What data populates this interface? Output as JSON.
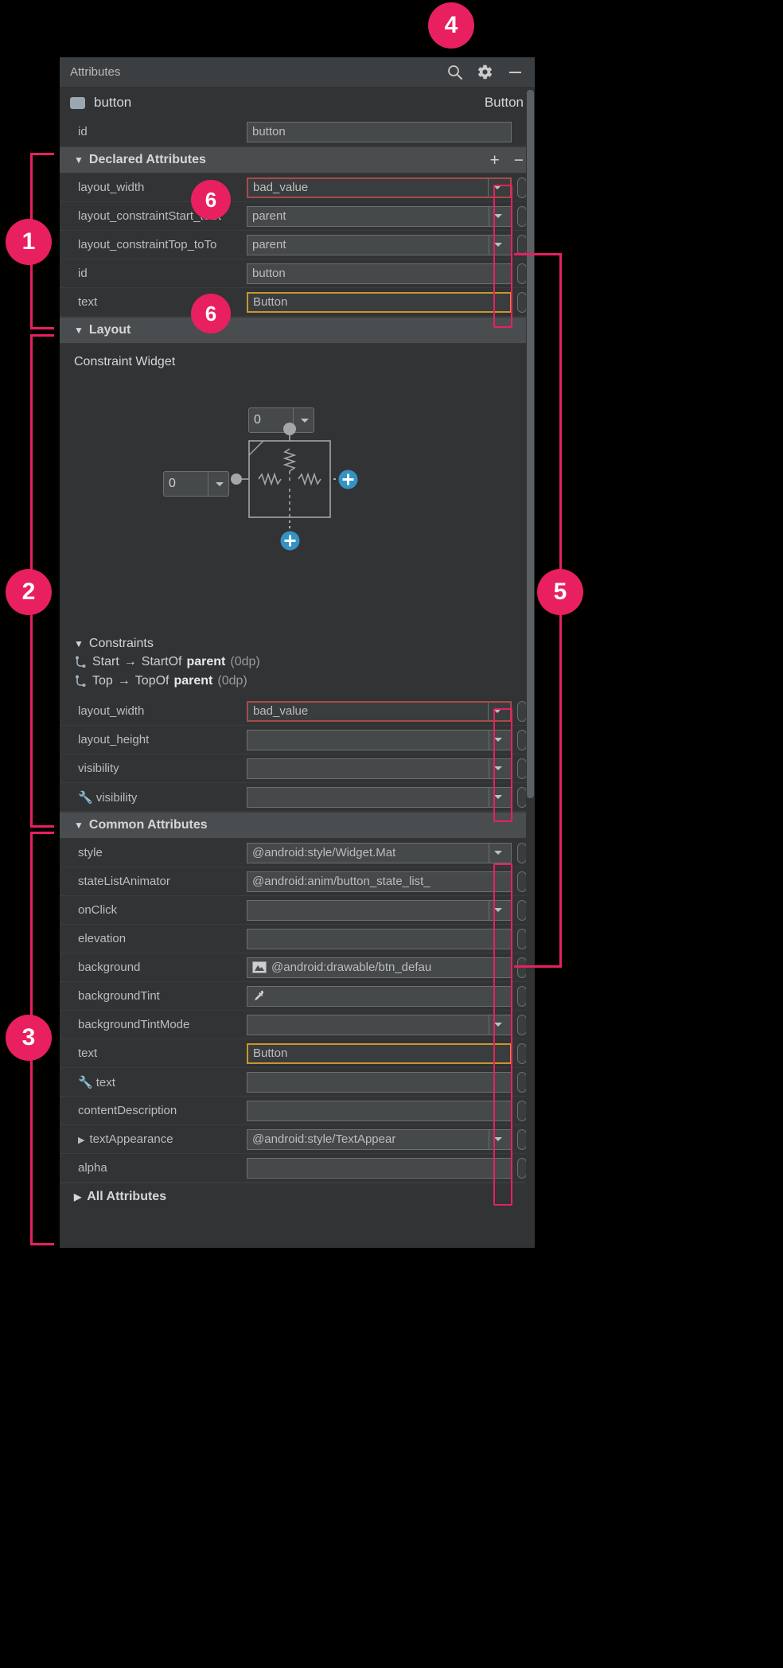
{
  "panel": {
    "title": "Attributes",
    "header_icons": [
      {
        "name": "search-icon",
        "label": "Search"
      },
      {
        "name": "gear-icon",
        "label": "Settings"
      },
      {
        "name": "minimize-icon",
        "label": "Minimize"
      }
    ],
    "component": {
      "name": "button",
      "type": "Button"
    },
    "id_row": {
      "label": "id",
      "value": "button"
    }
  },
  "declared": {
    "section_label": "Declared Attributes",
    "add_label": "+",
    "remove_label": "−",
    "rows": [
      {
        "label": "layout_width",
        "value": "bad_value",
        "state": "err",
        "dropdown": true
      },
      {
        "label": "layout_constraintStart_toSt",
        "value": "parent",
        "state": "none",
        "dropdown": true
      },
      {
        "label": "layout_constraintTop_toTo",
        "value": "parent",
        "state": "none",
        "dropdown": true
      },
      {
        "label": "id",
        "value": "button",
        "state": "none",
        "dropdown": false
      },
      {
        "label": "text",
        "value": "Button",
        "state": "warn",
        "dropdown": false
      }
    ]
  },
  "layout": {
    "section_label": "Layout",
    "widget_title": "Constraint Widget",
    "top_margin_value": "0",
    "left_margin_value": "0",
    "constraints_label": "Constraints",
    "constraint_lines": [
      {
        "from": "Start",
        "arrow": "→",
        "to": "StartOf",
        "target": "parent",
        "dp": "(0dp)"
      },
      {
        "from": "Top",
        "arrow": "→",
        "to": "TopOf",
        "target": "parent",
        "dp": "(0dp)"
      }
    ],
    "rows": [
      {
        "label": "layout_width",
        "value": "bad_value",
        "state": "err",
        "dropdown": true,
        "wrench": false
      },
      {
        "label": "layout_height",
        "value": "",
        "state": "none",
        "dropdown": true,
        "wrench": false
      },
      {
        "label": "visibility",
        "value": "",
        "state": "none",
        "dropdown": true,
        "wrench": false
      },
      {
        "label": "visibility",
        "value": "",
        "state": "none",
        "dropdown": true,
        "wrench": true
      }
    ]
  },
  "common": {
    "section_label": "Common Attributes",
    "rows": [
      {
        "label": "style",
        "value": "@android:style/Widget.Mat",
        "state": "none",
        "dropdown": true,
        "wrench": false,
        "icon": ""
      },
      {
        "label": "stateListAnimator",
        "value": "@android:anim/button_state_list_",
        "state": "none",
        "dropdown": false,
        "wrench": false,
        "icon": ""
      },
      {
        "label": "onClick",
        "value": "",
        "state": "none",
        "dropdown": true,
        "wrench": false,
        "icon": ""
      },
      {
        "label": "elevation",
        "value": "",
        "state": "none",
        "dropdown": false,
        "wrench": false,
        "icon": ""
      },
      {
        "label": "background",
        "value": "@android:drawable/btn_defau",
        "state": "none",
        "dropdown": false,
        "wrench": false,
        "icon": "image-icon"
      },
      {
        "label": "backgroundTint",
        "value": "",
        "state": "none",
        "dropdown": false,
        "wrench": false,
        "icon": "eyedropper-icon"
      },
      {
        "label": "backgroundTintMode",
        "value": "",
        "state": "none",
        "dropdown": true,
        "wrench": false,
        "icon": ""
      },
      {
        "label": "text",
        "value": "Button",
        "state": "warn",
        "dropdown": false,
        "wrench": false,
        "icon": ""
      },
      {
        "label": "text",
        "value": "",
        "state": "none",
        "dropdown": false,
        "wrench": true,
        "icon": ""
      },
      {
        "label": "contentDescription",
        "value": "",
        "state": "none",
        "dropdown": false,
        "wrench": false,
        "icon": ""
      },
      {
        "label": "textAppearance",
        "value": "@android:style/TextAppear",
        "state": "none",
        "dropdown": true,
        "wrench": false,
        "icon": "",
        "expander": "▶"
      },
      {
        "label": "alpha",
        "value": "",
        "state": "none",
        "dropdown": false,
        "wrench": false,
        "icon": ""
      }
    ]
  },
  "all_attributes": {
    "label": "All Attributes",
    "expander": "▶"
  },
  "callouts": [
    {
      "number": "1"
    },
    {
      "number": "2"
    },
    {
      "number": "3"
    },
    {
      "number": "4"
    },
    {
      "number": "5"
    },
    {
      "number": "6"
    },
    {
      "number": "6"
    }
  ],
  "colors": {
    "accent_pink": "#e8205f",
    "panel_bg": "#3c3f41",
    "body_bg": "#313335",
    "section_bg": "#4a4d4f",
    "error_border": "#a64b4b",
    "warn_border": "#c9962c",
    "link_blue": "#3592c4"
  }
}
